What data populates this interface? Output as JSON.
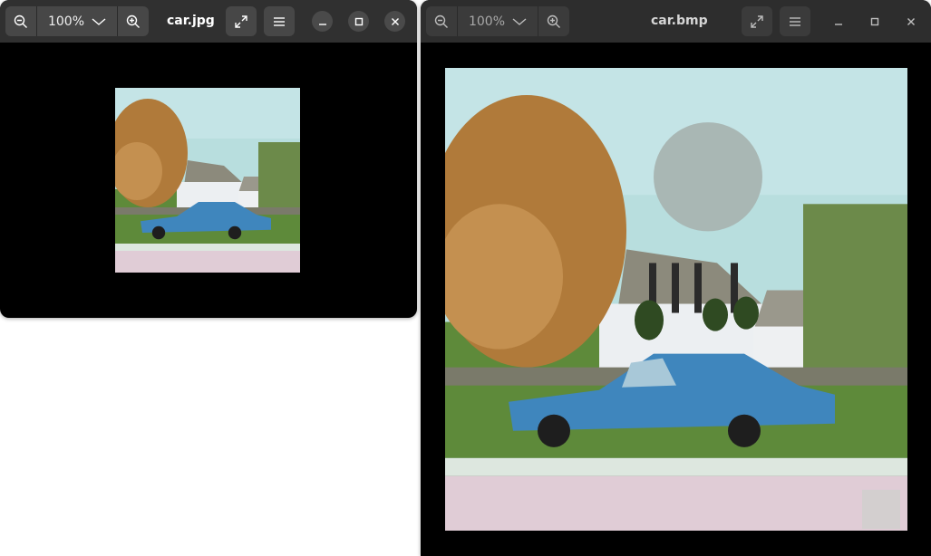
{
  "windows": [
    {
      "id": "jpg",
      "title": "car.jpg",
      "zoom_label": "100%",
      "focused": true
    },
    {
      "id": "bmp",
      "title": "car.bmp",
      "zoom_label": "100%",
      "focused": false
    }
  ],
  "icons": {
    "zoom_out": "zoom-out-icon",
    "zoom_in": "zoom-in-icon",
    "zoom_menu": "chevron-down-icon",
    "fullscreen": "fullscreen-icon",
    "menu": "hamburger-menu-icon",
    "minimize": "minimize-icon",
    "maximize": "maximize-icon",
    "close": "close-icon"
  },
  "colors": {
    "titlebar": "#303030",
    "canvas": "#000000",
    "button": "#474747"
  }
}
